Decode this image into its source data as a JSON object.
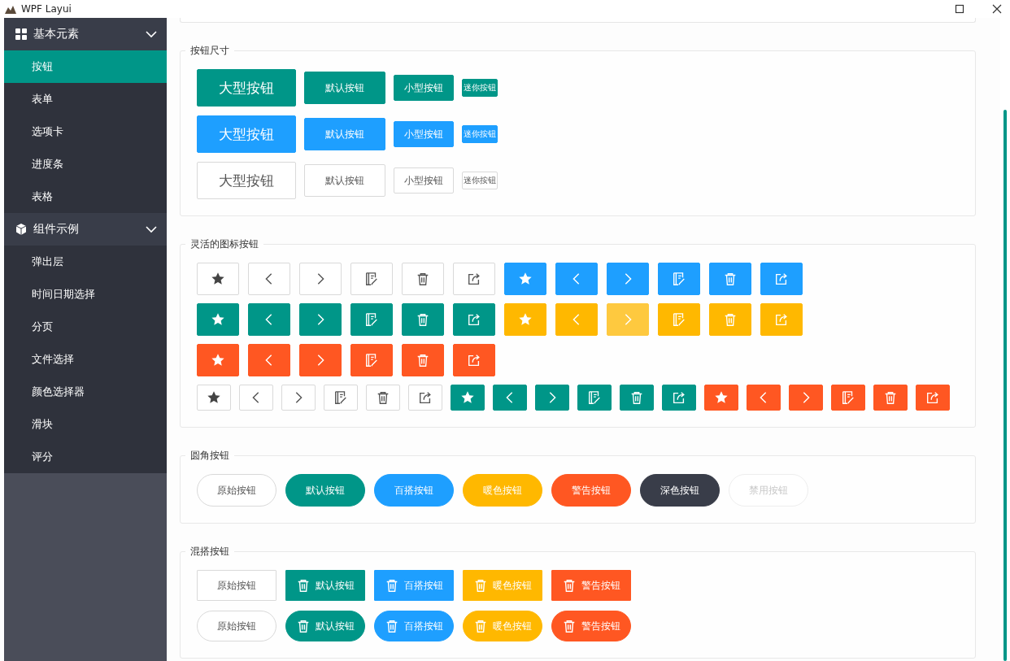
{
  "window": {
    "title": "WPF Layui"
  },
  "sidebar": {
    "groups": [
      {
        "label": "基本元素",
        "expanded": true,
        "items": [
          {
            "label": "按钮",
            "selected": true
          },
          {
            "label": "表单",
            "selected": false
          },
          {
            "label": "选项卡",
            "selected": false
          },
          {
            "label": "进度条",
            "selected": false
          },
          {
            "label": "表格",
            "selected": false
          }
        ]
      },
      {
        "label": "组件示例",
        "expanded": true,
        "items": [
          {
            "label": "弹出层",
            "selected": false
          },
          {
            "label": "时间日期选择",
            "selected": false
          },
          {
            "label": "分页",
            "selected": false
          },
          {
            "label": "文件选择",
            "selected": false
          },
          {
            "label": "颜色选择器",
            "selected": false
          },
          {
            "label": "滑块",
            "selected": false
          },
          {
            "label": "评分",
            "selected": false
          }
        ]
      }
    ]
  },
  "size_section": {
    "title": "按钮尺寸",
    "rows": [
      {
        "color": "#009688",
        "buttons": [
          {
            "label": "大型按钮",
            "kind": "large"
          },
          {
            "label": "默认按钮",
            "kind": "default"
          },
          {
            "label": "小型按钮",
            "kind": "small"
          },
          {
            "label": "迷你按钮",
            "kind": "mini"
          }
        ]
      },
      {
        "color": "#1e9fff",
        "buttons": [
          {
            "label": "大型按钮",
            "kind": "large"
          },
          {
            "label": "默认按钮",
            "kind": "default"
          },
          {
            "label": "小型按钮",
            "kind": "small"
          },
          {
            "label": "迷你按钮",
            "kind": "mini"
          }
        ]
      },
      {
        "color": "#ffffff",
        "buttons": [
          {
            "label": "大型按钮",
            "kind": "large"
          },
          {
            "label": "默认按钮",
            "kind": "default"
          },
          {
            "label": "小型按钮",
            "kind": "small"
          },
          {
            "label": "迷你按钮",
            "kind": "mini"
          }
        ]
      }
    ]
  },
  "icon_section": {
    "title": "灵活的图标按钮",
    "rows": [
      {
        "kind": "default",
        "groups": [
          {
            "color": "#ffffff",
            "hovered": [
              false,
              false,
              false,
              false,
              false,
              false
            ]
          },
          {
            "color": "#1e9fff",
            "hovered": [
              false,
              false,
              false,
              false,
              false,
              false
            ]
          }
        ]
      },
      {
        "kind": "default",
        "groups": [
          {
            "color": "#009688",
            "hovered": [
              false,
              false,
              false,
              false,
              false,
              false
            ]
          },
          {
            "color": "#ffb800",
            "hovered": [
              false,
              false,
              true,
              false,
              false,
              false
            ]
          }
        ]
      },
      {
        "kind": "default",
        "groups": [
          {
            "color": "#ff5722",
            "hovered": [
              false,
              false,
              false,
              false,
              false,
              false
            ]
          }
        ]
      },
      {
        "kind": "small",
        "groups": [
          {
            "color": "#ffffff",
            "hovered": [
              false,
              false,
              false,
              false,
              false,
              false
            ]
          },
          {
            "color": "#009688",
            "hovered": [
              false,
              false,
              false,
              false,
              false,
              false
            ]
          },
          {
            "color": "#ff5722",
            "hovered": [
              false,
              false,
              false,
              false,
              false,
              false
            ]
          }
        ]
      }
    ]
  },
  "round_section": {
    "title": "圆角按钮",
    "buttons": [
      {
        "label": "原始按钮",
        "color": "#ffffff",
        "disabled": false
      },
      {
        "label": "默认按钮",
        "color": "#009688",
        "disabled": false
      },
      {
        "label": "百搭按钮",
        "color": "#1e9fff",
        "disabled": false
      },
      {
        "label": "暖色按钮",
        "color": "#ffb800",
        "disabled": false
      },
      {
        "label": "警告按钮",
        "color": "#ff5722",
        "disabled": false
      },
      {
        "label": "深色按钮",
        "color": "#393d49",
        "disabled": false
      },
      {
        "label": "禁用按钮",
        "color": "#ffffff",
        "disabled": true
      }
    ]
  },
  "mixed_section": {
    "title": "混搭按钮",
    "rows": [
      {
        "kind": "square",
        "buttons": [
          {
            "label": "原始按钮",
            "color": "#ffffff",
            "kind": "text"
          },
          {
            "label": "默认按钮",
            "color": "#009688",
            "kind": "icon-text"
          },
          {
            "label": "百搭按钮",
            "color": "#1e9fff",
            "kind": "icon-text"
          },
          {
            "label": "暖色按钮",
            "color": "#ffb800",
            "kind": "icon-text"
          },
          {
            "label": "警告按钮",
            "color": "#ff5722",
            "kind": "icon-text"
          }
        ]
      },
      {
        "kind": "round",
        "buttons": [
          {
            "label": "原始按钮",
            "color": "#ffffff",
            "kind": "text"
          },
          {
            "label": "默认按钮",
            "color": "#009688",
            "kind": "icon-text"
          },
          {
            "label": "百搭按钮",
            "color": "#1e9fff",
            "kind": "icon-text"
          },
          {
            "label": "暖色按钮",
            "color": "#ffb800",
            "kind": "icon-text"
          },
          {
            "label": "警告按钮",
            "color": "#ff5722",
            "kind": "icon-text"
          }
        ]
      }
    ]
  }
}
